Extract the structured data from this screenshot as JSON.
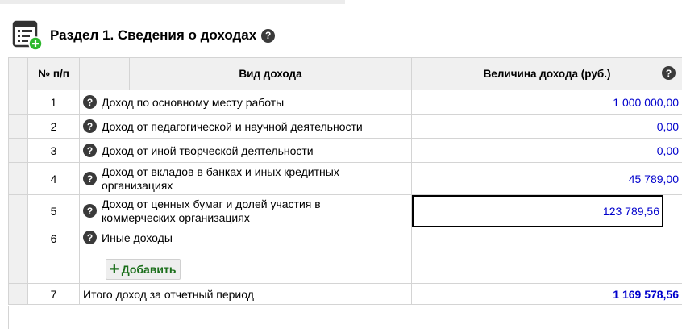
{
  "section": {
    "title": "Раздел 1. Сведения о доходах",
    "help_glyph": "?"
  },
  "table": {
    "headers": {
      "num": "№ п/п",
      "kind": "Вид дохода",
      "value": "Величина дохода (руб.)"
    },
    "rows": [
      {
        "num": "1",
        "kind": "Доход по основному месту работы",
        "value": "1 000 000,00"
      },
      {
        "num": "2",
        "kind": "Доход от педагогической и научной деятельности",
        "value": "0,00"
      },
      {
        "num": "3",
        "kind": "Доход от иной творческой деятельности",
        "value": "0,00"
      },
      {
        "num": "4",
        "kind": "Доход от вкладов в банках и иных кредитных организациях",
        "value": "45 789,00"
      },
      {
        "num": "5",
        "kind": "Доход от ценных бумаг и долей участия в коммерческих организациях",
        "value": "123 789,56"
      }
    ],
    "other": {
      "num": "6",
      "kind": "Иные доходы",
      "add_label": "Добавить"
    },
    "total": {
      "num": "7",
      "label": "Итого доход за отчетный период",
      "value": "1 169 578,56"
    }
  },
  "colors": {
    "value_blue": "#0000cc",
    "add_green": "#1a6e1a",
    "icon_green": "#2eb82e"
  }
}
